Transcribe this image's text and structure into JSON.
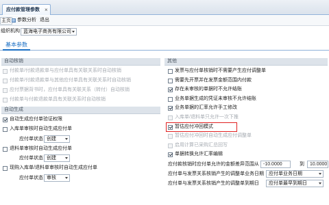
{
  "colors": {
    "accent": "#1a6fc4",
    "tab_line": "#8fb1d9",
    "header_band": "#dde3ea",
    "highlight": "#e02020",
    "disabled_text": "#a6abb2"
  },
  "icons": {
    "close": "close-icon",
    "dropdown": "chevron-down-icon",
    "check": "check-icon",
    "analyze": "analyze-icon"
  },
  "window_tab": {
    "title": "应付款管理参数",
    "close": "×"
  },
  "toolbar": {
    "home": "主页",
    "analyze": "参数分析",
    "exit": "退出"
  },
  "org": {
    "label": "组织机构",
    "value": "蓝海电子商务有限公司"
  },
  "page_tabs": [
    {
      "label": "基本参数",
      "active": true
    }
  ],
  "auto_writeoff": {
    "title": "自动核销",
    "items": [
      {
        "label": "付款单/付款退款单与应付单具有关联关系时自动核销",
        "checked": false,
        "disabled": true
      },
      {
        "label": "付款单/付款退款单与其他应付单具有关联关系时自动核销",
        "checked": false,
        "disabled": true
      },
      {
        "label": "应付票据背书时，应付单具有关联关系（转付）自动核销",
        "checked": false,
        "disabled": true
      },
      {
        "label": "付款单与付款退款单具有关联关系时自动核销",
        "checked": false,
        "disabled": true
      }
    ]
  },
  "auto_generate": {
    "title": "自动生成",
    "verify": {
      "label": "自动生成应付单验证权限",
      "checked": true
    },
    "groups": [
      {
        "label": "入库单审核时自动生成应付单",
        "checked": false,
        "status_label": "应付单状态",
        "status": "创建"
      },
      {
        "label": "退料单审核时自动生成应付单",
        "checked": false,
        "status_label": "应付单状态",
        "status": "创建"
      },
      {
        "label": "现购入库单/退料单审核时自动生成应付单",
        "checked": false,
        "status_label": "应付单状态",
        "status": "审核"
      }
    ]
  },
  "other": {
    "title": "其他",
    "items": [
      {
        "label": "发票与应付单核销时不需要产生应付调整单",
        "checked": false
      },
      {
        "label": "需要先开票并在发票金额范围内付款",
        "checked": false
      },
      {
        "label": "存在未审核的单据时不允许结账",
        "checked": true
      },
      {
        "label": "业务单据生成的凭证未审核不允许结账",
        "checked": false
      },
      {
        "label": "业务单据的汇率允许手工修改",
        "checked": true
      },
      {
        "label": "入库单/退料单只允许一次下推",
        "checked": false,
        "disabled": true
      },
      {
        "label": "暂估应付冲回模式",
        "checked": true,
        "highlighted": true
      },
      {
        "label": "暂估应付冲回时自动生成应付调整单",
        "checked": false,
        "disabled": true
      },
      {
        "label": "启用计算已采购汇总回写",
        "checked": false,
        "disabled": true
      },
      {
        "label": "单据转换允许汇率编辑",
        "checked": true
      }
    ],
    "diff_range": {
      "label": "应付款核销时应付单允许的金额差异范围从",
      "from": "-10.0000",
      "to_label": "到",
      "to": "10.0000"
    },
    "adjust_business_date": {
      "label": "应付单与发票关系核销产生的调整单业务日期",
      "value": "应付单业务日期"
    },
    "adjust_due_date": {
      "label": "应付单与发票关系核销产生的调整单到期日",
      "value": "应付单最早到期日"
    }
  }
}
